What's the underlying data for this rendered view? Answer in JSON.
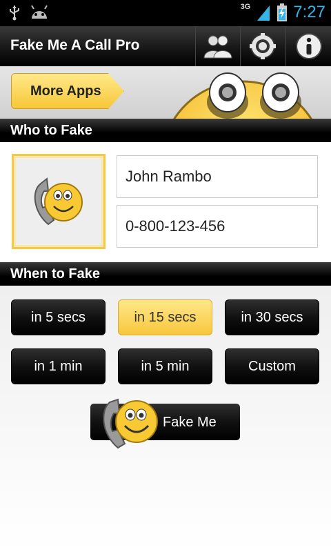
{
  "status_bar": {
    "time": "7:27",
    "network": "3G",
    "left_icons": [
      "usb-icon",
      "android-debug-icon"
    ],
    "right_icons": [
      "signal-icon",
      "battery-charging-icon"
    ]
  },
  "action_bar": {
    "title": "Fake Me A Call Pro",
    "buttons": [
      "contacts-icon",
      "settings-icon",
      "info-icon"
    ]
  },
  "banner": {
    "more_apps_label": "More Apps"
  },
  "who_section": {
    "header": "Who to Fake",
    "name_value": "John Rambo",
    "number_value": "0-800-123-456"
  },
  "when_section": {
    "header": "When to Fake",
    "options": [
      {
        "label": "in 5 secs",
        "selected": false
      },
      {
        "label": "in 15 secs",
        "selected": true
      },
      {
        "label": "in 30 secs",
        "selected": false
      },
      {
        "label": "in 1 min",
        "selected": false
      },
      {
        "label": "in 5 min",
        "selected": false
      },
      {
        "label": "Custom",
        "selected": false
      }
    ]
  },
  "fake_button": {
    "label": "Fake Me"
  },
  "colors": {
    "accent_yellow": "#f8c73c",
    "clock_blue": "#33b5e5",
    "header_black": "#000000"
  }
}
